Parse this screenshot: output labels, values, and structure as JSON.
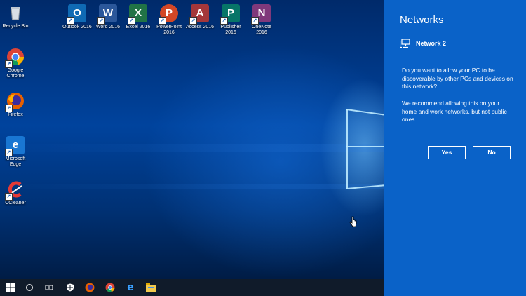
{
  "desktop": {
    "icons_left": [
      {
        "label": "Recycle Bin",
        "icon": "recycle-bin-icon"
      },
      {
        "label": "Google Chrome",
        "icon": "chrome-icon"
      },
      {
        "label": "Firefox",
        "icon": "firefox-icon"
      },
      {
        "label": "Microsoft Edge",
        "icon": "edge-icon"
      },
      {
        "label": "CCleaner",
        "icon": "ccleaner-icon"
      }
    ],
    "icons_top": [
      {
        "label": "Outlook 2016",
        "letter": "O",
        "color": "#0f6ab4"
      },
      {
        "label": "Word 2016",
        "letter": "W",
        "color": "#2b579a"
      },
      {
        "label": "Excel 2016",
        "letter": "X",
        "color": "#217346"
      },
      {
        "label": "PowerPoint 2016",
        "letter": "P",
        "color": "#d24726"
      },
      {
        "label": "Access 2016",
        "letter": "A",
        "color": "#a4373a"
      },
      {
        "label": "Publisher 2016",
        "letter": "P",
        "color": "#077568"
      },
      {
        "label": "OneNote 2016",
        "letter": "N",
        "color": "#80397b"
      }
    ]
  },
  "taskbar": {
    "items": [
      "start-icon",
      "search-icon",
      "task-view-icon",
      "security-icon",
      "firefox-icon",
      "chrome-icon",
      "edge-icon",
      "file-explorer-icon"
    ]
  },
  "networks_panel": {
    "title": "Networks",
    "network_name": "Network 2",
    "question": "Do you want to allow your PC to be discoverable by other PCs and devices on this network?",
    "recommendation": "We recommend allowing this on your home and work networks, but not public ones.",
    "yes_label": "Yes",
    "no_label": "No",
    "background_color": "#0a62c8"
  }
}
